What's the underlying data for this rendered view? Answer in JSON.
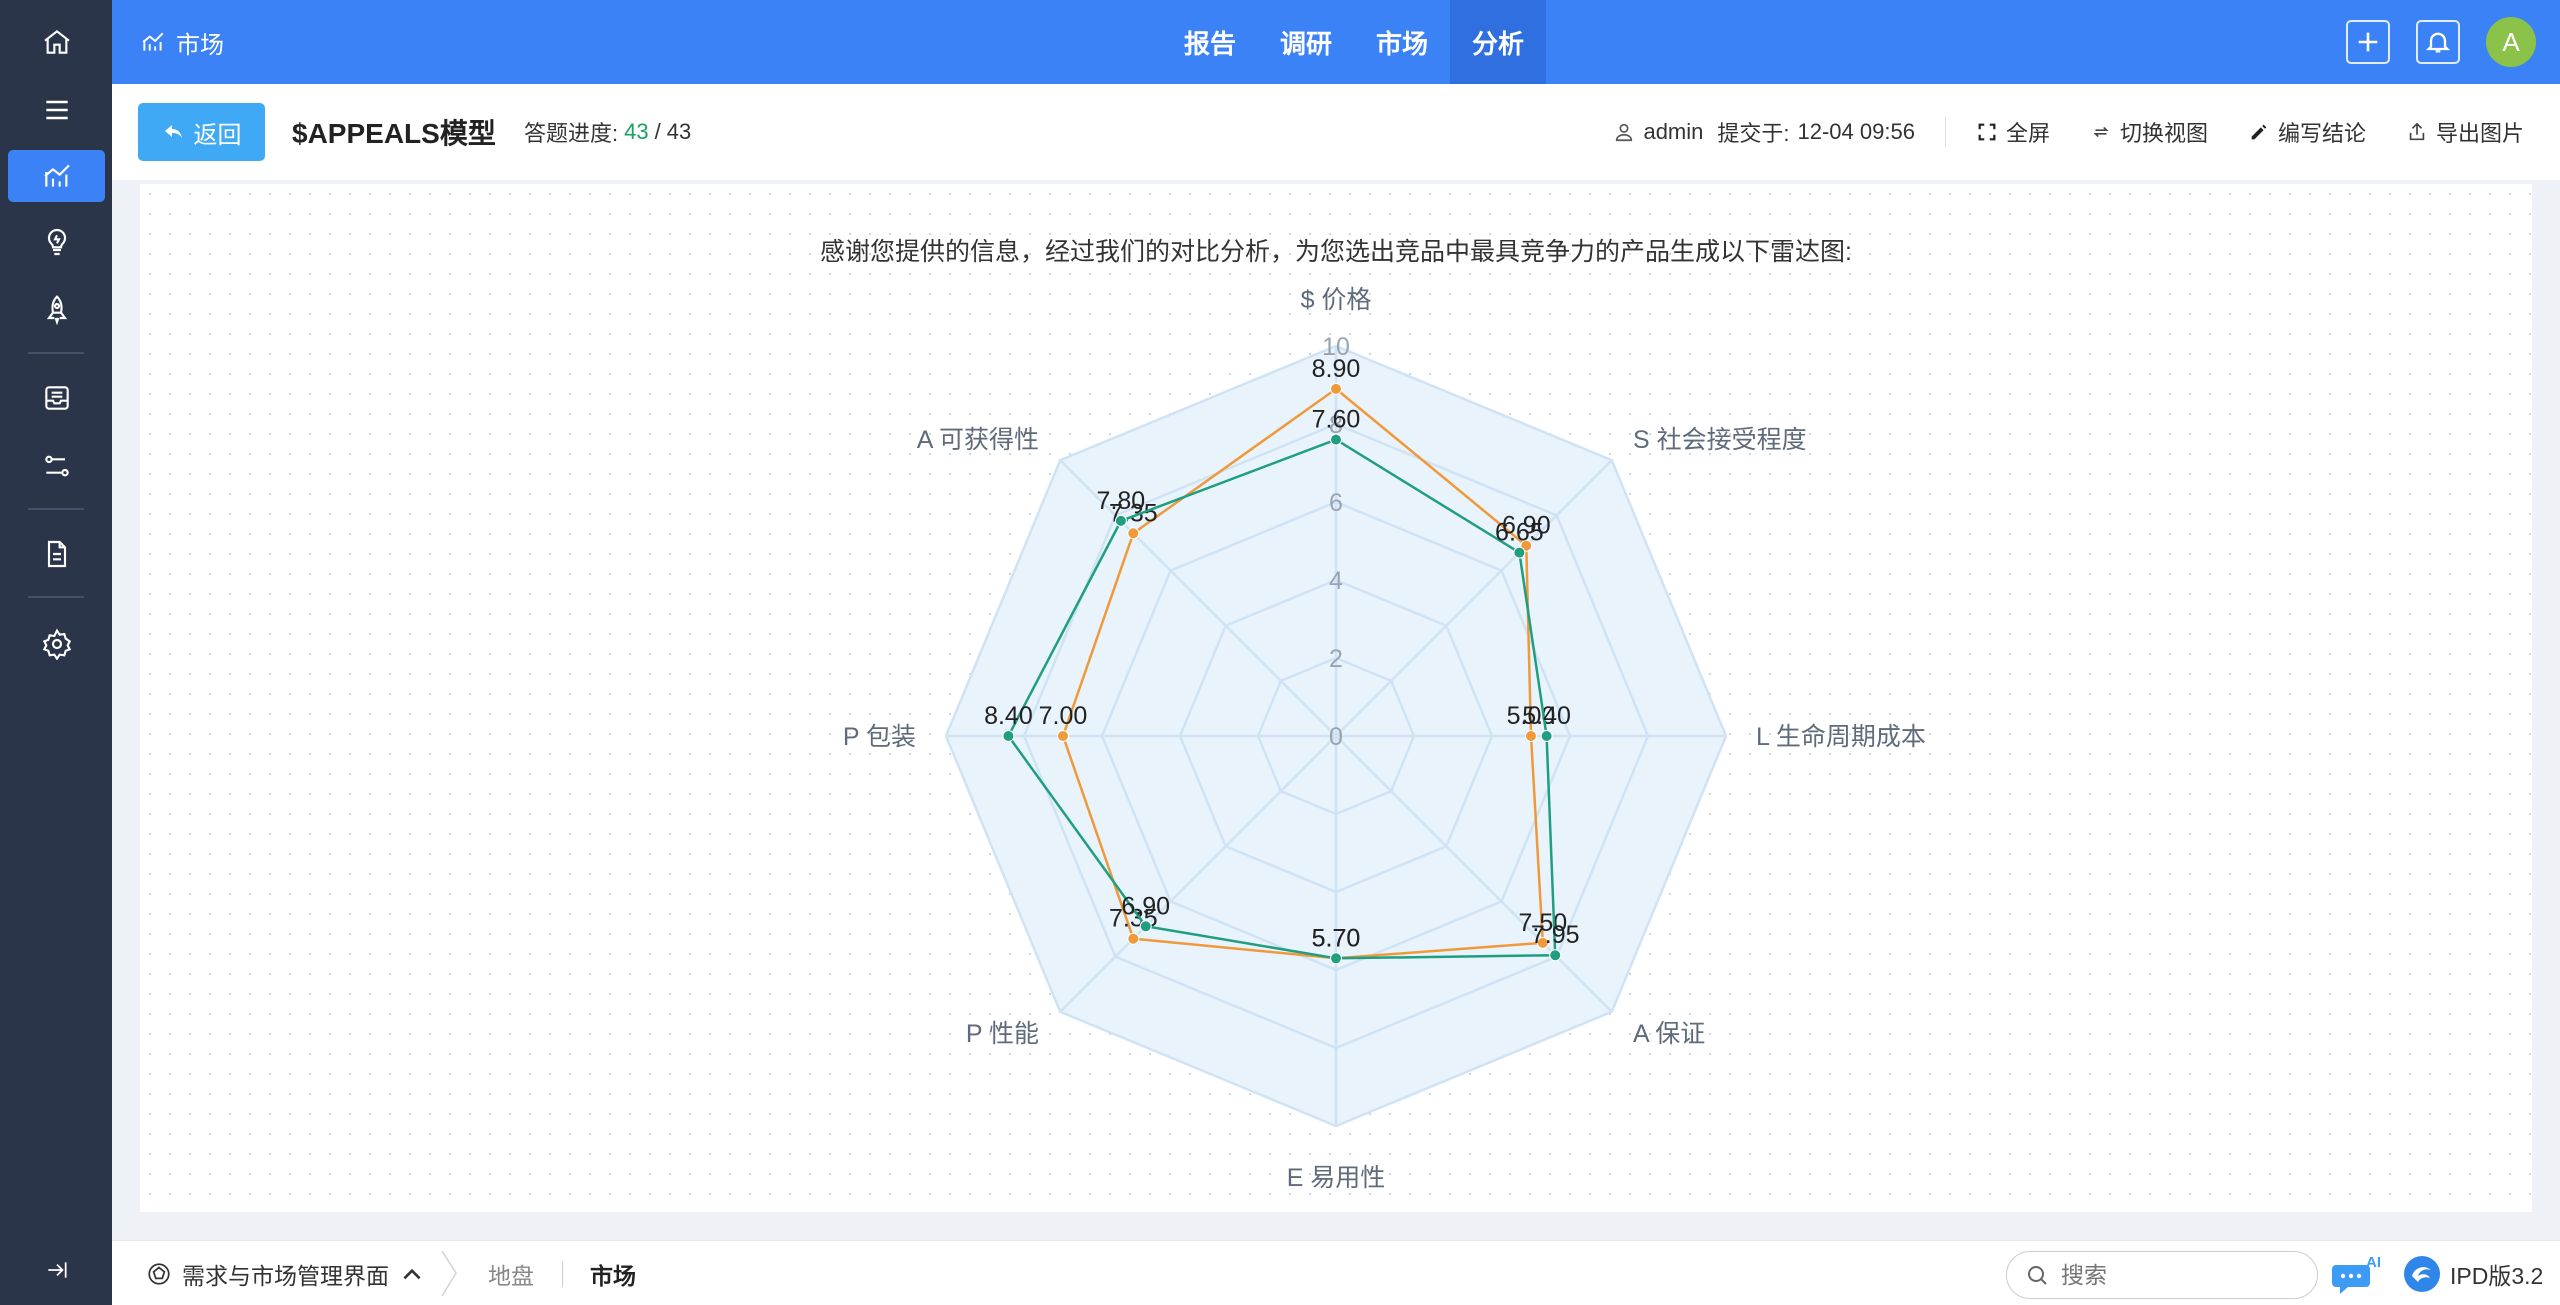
{
  "topbar": {
    "section_title": "市场",
    "nav": [
      "报告",
      "调研",
      "市场",
      "分析"
    ],
    "active_nav": 3,
    "avatar_letter": "A"
  },
  "toolbar": {
    "back_label": "返回",
    "title": "$APPEALS模型",
    "progress_label": "答题进度:",
    "progress_done": "43",
    "progress_sep": "/",
    "progress_total": "43",
    "user": "admin",
    "submitted_label": "提交于:",
    "submitted_time": "12-04 09:56",
    "actions": {
      "fullscreen": "全屏",
      "switch_view": "切换视图",
      "write_conclusion": "编写结论",
      "export_image": "导出图片"
    }
  },
  "content": {
    "intro": "感谢您提供的信息，经过我们的对比分析，为您选出竞品中最具竞争力的产品生成以下雷达图:"
  },
  "chart_data": {
    "type": "radar",
    "axes": [
      "$ 价格",
      "S 社会接受程度",
      "L 生命周期成本",
      "A 保证",
      "E 易用性",
      "P 性能",
      "P 包装",
      "A 可获得性"
    ],
    "range": [
      0,
      10
    ],
    "ticks": [
      0,
      2,
      4,
      6,
      8,
      10
    ],
    "series": [
      {
        "color": "#f0993a",
        "values": [
          8.9,
          6.9,
          5.0,
          7.5,
          5.7,
          7.35,
          7.0,
          7.35
        ],
        "labels": [
          "8.90",
          "6.90",
          "5.00",
          "7.50",
          "5.70",
          "7.35",
          "7.00",
          "7.35"
        ]
      },
      {
        "color": "#1f9e80",
        "values": [
          7.6,
          6.65,
          5.4,
          7.95,
          5.7,
          6.9,
          8.4,
          7.8
        ],
        "labels": [
          "7.60",
          "6.65",
          "5.40",
          "7.95",
          "5.70",
          "6.90",
          "8.40",
          "7.80"
        ]
      }
    ],
    "colors": {
      "grid": "#cfe3f5",
      "band_fill": "#e8f3fc",
      "axis_label": "#5f6b7a",
      "tick_label": "#9aa4b0"
    }
  },
  "bottombar": {
    "module": "需求与市场管理界面",
    "breadcrumb": [
      "地盘",
      "市场"
    ],
    "search_placeholder": "搜索",
    "version": "IPD版3.2"
  },
  "colors": {
    "primary": "#3b82f6",
    "sidebar": "#2b3549",
    "success": "#19a15f"
  }
}
